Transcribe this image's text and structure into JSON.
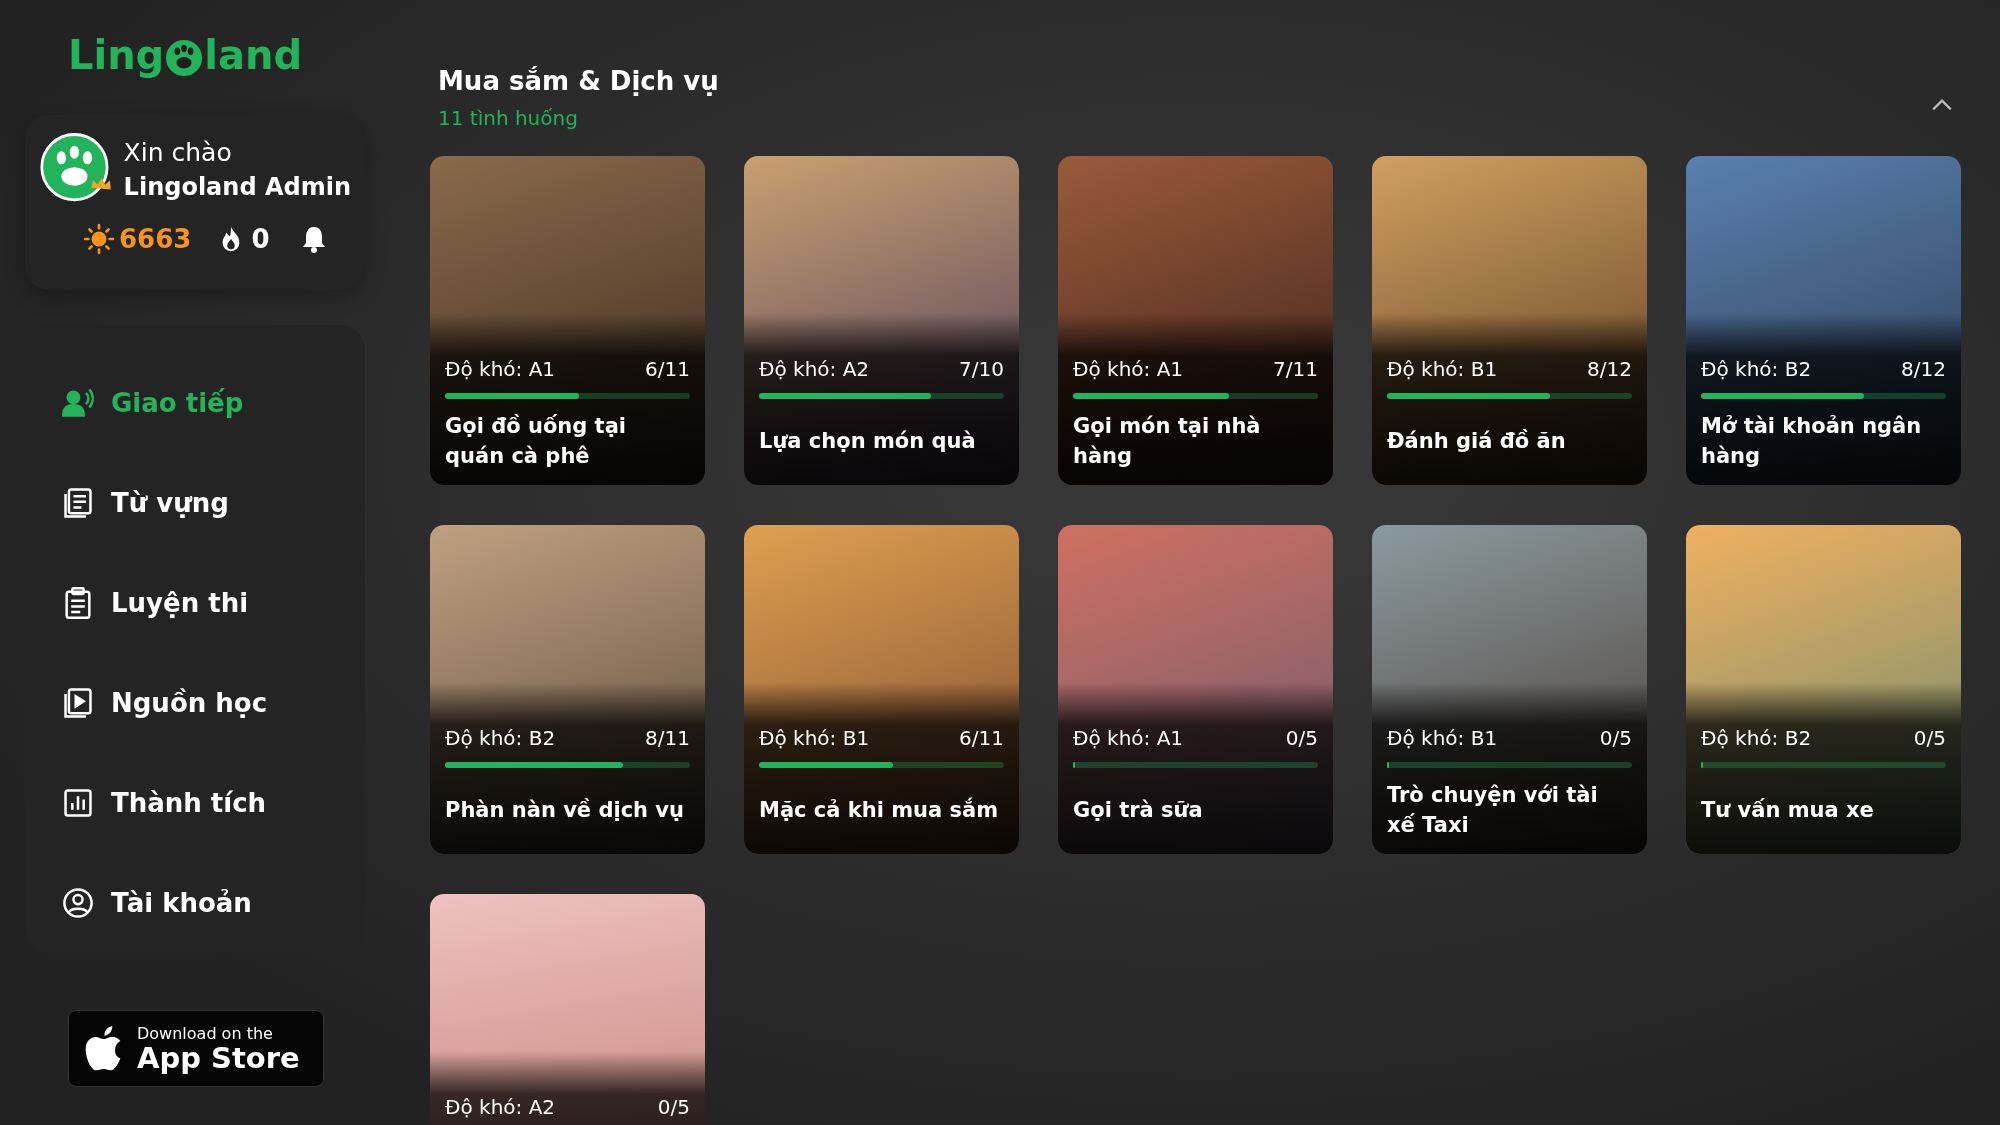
{
  "logo": {
    "left": "Ling",
    "right": "land"
  },
  "profile": {
    "greeting": "Xin chào",
    "name": "Lingoland Admin",
    "points": "6663",
    "streak": "0"
  },
  "nav": [
    {
      "label": "Giao tiếp",
      "selected": true,
      "kind": "chat"
    },
    {
      "label": "Từ vựng",
      "selected": false,
      "kind": "vocab"
    },
    {
      "label": "Luyện thi",
      "selected": false,
      "kind": "exam"
    },
    {
      "label": "Nguồn học",
      "selected": false,
      "kind": "media"
    },
    {
      "label": "Thành tích",
      "selected": false,
      "kind": "chart"
    },
    {
      "label": "Tài khoản",
      "selected": false,
      "kind": "account"
    }
  ],
  "store_button": {
    "small": "Download on the",
    "big": "App Store"
  },
  "section": {
    "title": "Mua sắm & Dịch vụ",
    "subtitle": "11 tình huống",
    "expanded": true
  },
  "cards": [
    {
      "difficulty": "Độ khó: A1",
      "progress": "6/11",
      "level": 0.545,
      "title": "Gọi đồ uống tại quán cà phê"
    },
    {
      "difficulty": "Độ khó: A2",
      "progress": "7/10",
      "level": 0.7,
      "title": "Lựa chọn món quà"
    },
    {
      "difficulty": "Độ khó: A1",
      "progress": "7/11",
      "level": 0.636,
      "title": "Gọi món tại nhà hàng"
    },
    {
      "difficulty": "Độ khó: B1",
      "progress": "8/12",
      "level": 0.667,
      "title": "Đánh giá đồ ăn"
    },
    {
      "difficulty": "Độ khó: B2",
      "progress": "8/12",
      "level": 0.667,
      "title": "Mở tài khoản ngân hàng"
    },
    {
      "difficulty": "Độ khó: B2",
      "progress": "8/11",
      "level": 0.727,
      "title": "Phàn nàn về dịch vụ"
    },
    {
      "difficulty": "Độ khó: B1",
      "progress": "6/11",
      "level": 0.545,
      "title": "Mặc cả khi mua sắm"
    },
    {
      "difficulty": "Độ khó: A1",
      "progress": "0/5",
      "level": 0,
      "title": "Gọi trà sữa"
    },
    {
      "difficulty": "Độ khó: B1",
      "progress": "0/5",
      "level": 0,
      "title": "Trò chuyện với tài xế Taxi"
    },
    {
      "difficulty": "Độ khó: B2",
      "progress": "0/5",
      "level": 0,
      "title": "Tư vấn mua xe"
    },
    {
      "difficulty": "Độ khó: A2",
      "progress": "0/5"
    }
  ]
}
